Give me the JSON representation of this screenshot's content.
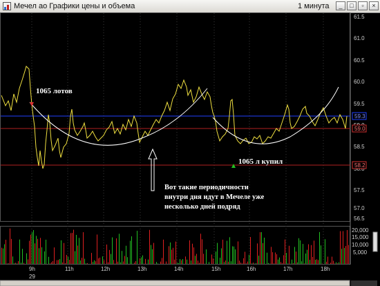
{
  "window": {
    "title": "Мечел ао Графики цены и объема",
    "interval": "1 минута"
  },
  "price_axis": {
    "ticks": [
      "61.5",
      "61.0",
      "60.5",
      "60.0",
      "59.5",
      "59.0",
      "58.5",
      "58.0",
      "57.5",
      "57.0",
      "56.5"
    ],
    "markers": [
      {
        "label": "59.3",
        "color": "#2040ff"
      },
      {
        "label": "59.0",
        "color": "#d03030"
      },
      {
        "label": "58.2",
        "color": "#d03030"
      }
    ]
  },
  "volume_axis": {
    "ticks": [
      "20,000",
      "15,000",
      "10,000",
      "5,000"
    ]
  },
  "time_axis": {
    "ticks": [
      "9h",
      "11h",
      "12h",
      "13h",
      "14h",
      "15h",
      "16h",
      "17h",
      "18h"
    ],
    "day_label": "29"
  },
  "annotations": {
    "lots": "1065 лотов",
    "bought": "1065 л купил",
    "comment_line1": "Вот такие периодичности",
    "comment_line2": "внутри дня идут в Мечеле уже",
    "comment_line3": "несколько дней подряд"
  },
  "colors": {
    "price_line": "#f0e040",
    "volume_up": "#22c022",
    "volume_down": "#e02020",
    "blue_level": "#2040ff",
    "red_level": "#b02020",
    "arc": "#ffffff"
  }
}
